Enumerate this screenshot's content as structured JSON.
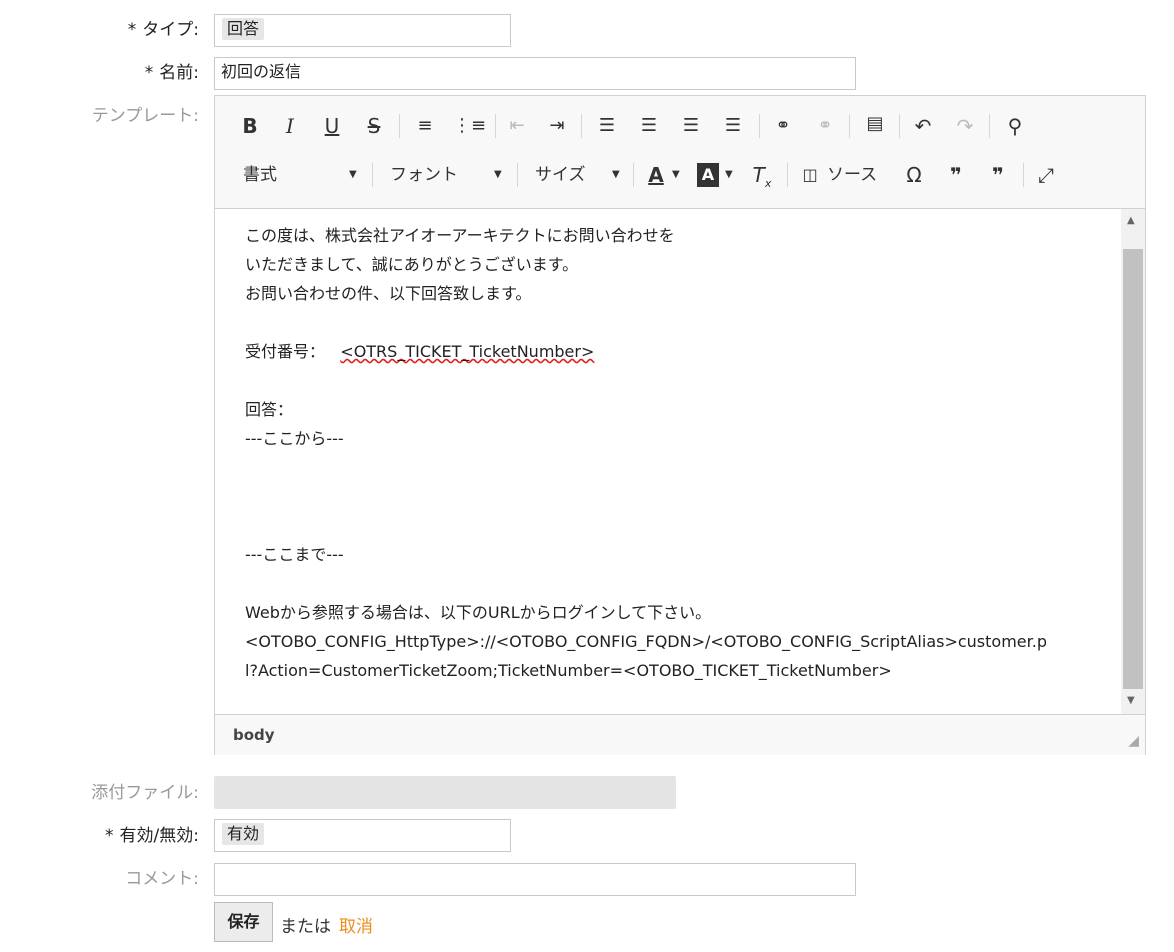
{
  "form": {
    "type": {
      "label": "タイプ:",
      "required": true,
      "value": "回答"
    },
    "name": {
      "label": "名前:",
      "required": true,
      "value": "初回の返信"
    },
    "template": {
      "label": "テンプレート:",
      "required": false
    },
    "attachment": {
      "label": "添付ファイル:",
      "required": false
    },
    "validity": {
      "label": "有効/無効:",
      "required": true,
      "value": "有効"
    },
    "comment": {
      "label": "コメント:",
      "required": false,
      "value": ""
    },
    "required_mark": "*"
  },
  "editor": {
    "toolbar": {
      "format_label": "書式",
      "font_label": "フォント",
      "size_label": "サイズ",
      "source_label": "ソース"
    },
    "content": {
      "line1": "この度は、株式会社アイオーアーキテクトにお問い合わせを",
      "line2": "いただきまして、誠にありがとうございます。",
      "line3": "お問い合わせの件、以下回答致します。",
      "line4a": "受付番号：",
      "line4b": "<OTRS_TICKET_TicketNumber>",
      "line5": "回答：",
      "line6": "---ここから---",
      "line7": "---ここまで---",
      "line8": "Webから参照する場合は、以下のURLからログインして下さい。",
      "line9": "<OTOBO_CONFIG_HttpType>://<OTOBO_CONFIG_FQDN>/<OTOBO_CONFIG_ScriptAlias>customer.p",
      "line10": "l?Action=CustomerTicketZoom;TicketNumber=<OTOBO_TICKET_TicketNumber>"
    },
    "status_path": "body"
  },
  "actions": {
    "save_label": "保存",
    "or_label": "または",
    "cancel_label": "取消"
  },
  "colors": {
    "cancel_link": "#f08c1e",
    "spellcheck_underline": "#e02020"
  }
}
